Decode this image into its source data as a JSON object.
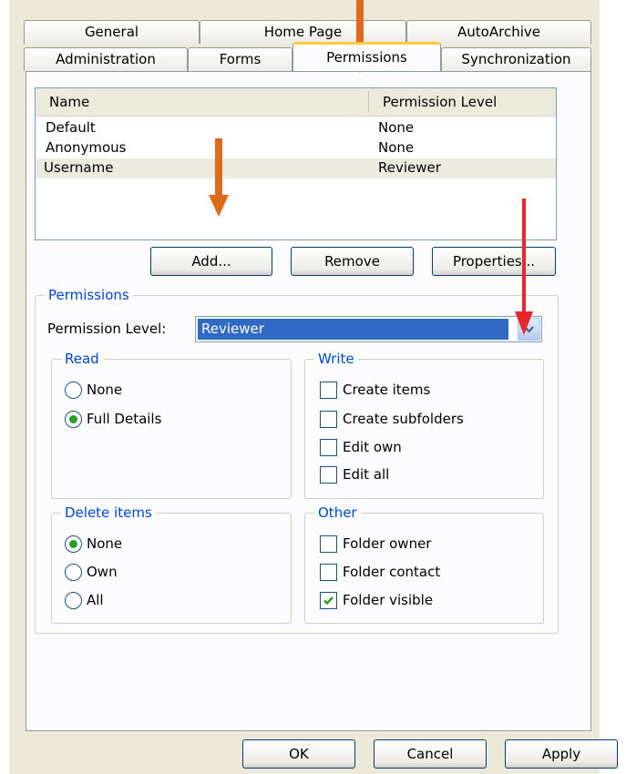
{
  "tabs": {
    "row1": [
      "General",
      "Home Page",
      "AutoArchive"
    ],
    "row2": [
      "Administration",
      "Forms",
      "Permissions",
      "Synchronization"
    ],
    "active": "Permissions"
  },
  "list": {
    "columns": [
      "Name",
      "Permission Level"
    ],
    "rows": [
      {
        "name": "Default",
        "level": "None"
      },
      {
        "name": "Anonymous",
        "level": "None"
      },
      {
        "name": "Username",
        "level": "Reviewer"
      }
    ]
  },
  "buttons": {
    "add": "Add...",
    "remove": "Remove",
    "properties": "Properties..."
  },
  "permissions": {
    "group_label": "Permissions",
    "level_label": "Permission Level:",
    "level_value": "Reviewer",
    "read": {
      "label": "Read",
      "options": [
        "None",
        "Full Details"
      ],
      "selected": "Full Details"
    },
    "write": {
      "label": "Write",
      "options": [
        "Create items",
        "Create subfolders",
        "Edit own",
        "Edit all"
      ],
      "checked": [
        false,
        false,
        false,
        false
      ]
    },
    "delete": {
      "label": "Delete items",
      "options": [
        "None",
        "Own",
        "All"
      ],
      "selected": "None"
    },
    "other": {
      "label": "Other",
      "options": [
        "Folder owner",
        "Folder contact",
        "Folder visible"
      ],
      "checked": [
        false,
        false,
        true
      ]
    }
  },
  "footer": {
    "ok": "OK",
    "cancel": "Cancel",
    "apply": "Apply"
  },
  "colors": {
    "annotation_orange": "#e06a1a",
    "annotation_red": "#e8272a",
    "selection_blue": "#316ac5",
    "group_label_blue": "#0046d5",
    "radio_green": "#21a121"
  }
}
